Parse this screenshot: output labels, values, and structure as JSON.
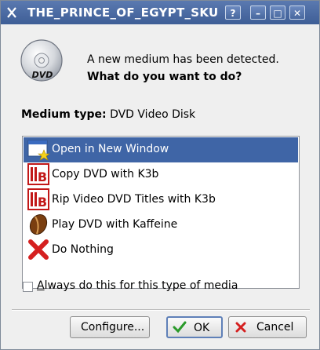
{
  "window": {
    "title": "THE_PRINCE_OF_EGYPT_SKU",
    "buttons": {
      "help": "?",
      "minimize": "–",
      "maximize": "□",
      "close": "✕"
    }
  },
  "dialog": {
    "message_line1": "A new medium has been detected.",
    "message_line2": "What do you want to do?",
    "medium_type_label": "Medium type:",
    "medium_type_value": "DVD Video Disk",
    "disc_label": "DVD"
  },
  "actions": [
    {
      "label": "Open in New Window",
      "icon": "open-window-icon",
      "selected": true
    },
    {
      "label": "Copy DVD with K3b",
      "icon": "k3b-icon",
      "selected": false
    },
    {
      "label": "Rip Video DVD Titles with K3b",
      "icon": "k3b-icon",
      "selected": false
    },
    {
      "label": "Play DVD with Kaffeine",
      "icon": "kaffeine-icon",
      "selected": false
    },
    {
      "label": "Do Nothing",
      "icon": "red-x-icon",
      "selected": false
    }
  ],
  "always": {
    "prefix": "A",
    "rest": "lways do this for this type of media",
    "checked": false
  },
  "buttons": {
    "configure": "Configure...",
    "ok": "OK",
    "cancel": "Cancel"
  },
  "colors": {
    "titlebar": "#4a6aa3",
    "selection": "#3f65a6",
    "ok_check": "#2a9a2a",
    "cancel_x": "#d52020"
  }
}
